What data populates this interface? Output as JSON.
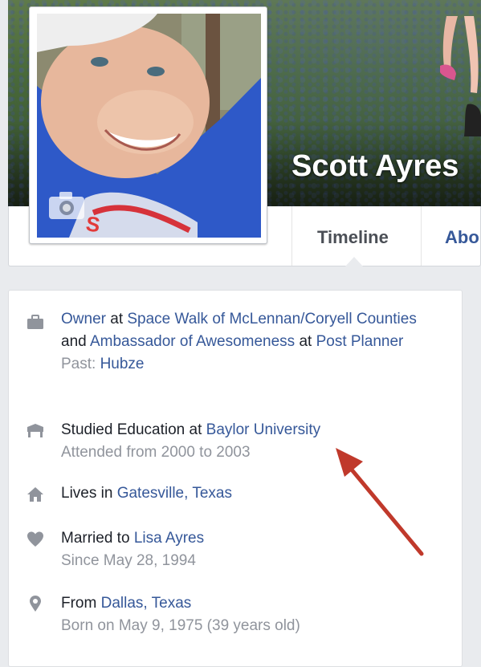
{
  "profile": {
    "name": "Scott Ayres"
  },
  "tabs": [
    {
      "label": "Timeline"
    },
    {
      "label": "Abo"
    }
  ],
  "intro": {
    "work": {
      "role": "Owner",
      "at1": " at ",
      "company1": "Space Walk of McLennan/Coryell Counties",
      "and": " and ",
      "role2": "Ambassador of Awesomeness",
      "at2": " at ",
      "company2": "Post Planner",
      "past_label": "Past: ",
      "past_company": "Hubze"
    },
    "education": {
      "prefix": "Studied Education at ",
      "school": "Baylor University",
      "detail": "Attended from 2000 to 2003"
    },
    "lives": {
      "prefix": "Lives in ",
      "place": "Gatesville, Texas"
    },
    "married": {
      "prefix": "Married to ",
      "spouse": "Lisa Ayres",
      "detail": "Since May 28, 1994"
    },
    "from": {
      "prefix": "From ",
      "place": "Dallas, Texas",
      "detail": "Born on May 9, 1975 (39 years old)"
    }
  },
  "icons": {
    "work": "briefcase-icon",
    "education": "graduation-cap-icon",
    "home": "house-icon",
    "relationship": "heart-icon",
    "hometown": "map-pin-icon",
    "camera": "camera-icon"
  },
  "colors": {
    "link": "#365899",
    "muted": "#90949c",
    "icon": "#90949c",
    "arrow": "#c0392b"
  }
}
